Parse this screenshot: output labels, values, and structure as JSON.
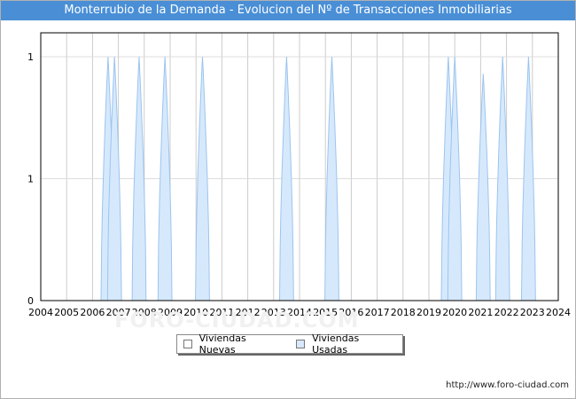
{
  "chart_data": {
    "type": "area",
    "title": "Monterrubio de la Demanda - Evolucion del Nº de Transacciones Inmobiliarias",
    "xlabel": "",
    "ylabel": "",
    "x_ticks": [
      "2004",
      "2005",
      "2006",
      "2007",
      "2008",
      "2009",
      "2010",
      "2011",
      "2012",
      "2013",
      "2014",
      "2015",
      "2016",
      "2017",
      "2018",
      "2019",
      "2020",
      "2021",
      "2022",
      "2023",
      "2024"
    ],
    "y_tick_labels": [
      "0",
      "1",
      "1"
    ],
    "y_tick_values": [
      0,
      0.5,
      1
    ],
    "xlim": [
      2004,
      2024
    ],
    "ylim": [
      0,
      1
    ],
    "grid": true,
    "legend_position": "bottom",
    "series": [
      {
        "name": "Viviendas Nuevas",
        "color": "#ffffff",
        "peaks": []
      },
      {
        "name": "Viviendas Usadas",
        "color": "#d6e9fc",
        "peaks": [
          {
            "x": 2006.6,
            "value": 1
          },
          {
            "x": 2006.85,
            "value": 1
          },
          {
            "x": 2007.8,
            "value": 1
          },
          {
            "x": 2008.8,
            "value": 1
          },
          {
            "x": 2010.25,
            "value": 1
          },
          {
            "x": 2013.5,
            "value": 1
          },
          {
            "x": 2015.25,
            "value": 1
          },
          {
            "x": 2019.75,
            "value": 1
          },
          {
            "x": 2020.0,
            "value": 1
          },
          {
            "x": 2021.1,
            "value": 0.93
          },
          {
            "x": 2021.85,
            "value": 1
          },
          {
            "x": 2022.85,
            "value": 1
          }
        ]
      }
    ]
  },
  "footer": {
    "url": "http://www.foro-ciudad.com"
  },
  "watermark": "FORO-CIUDAD.COM"
}
